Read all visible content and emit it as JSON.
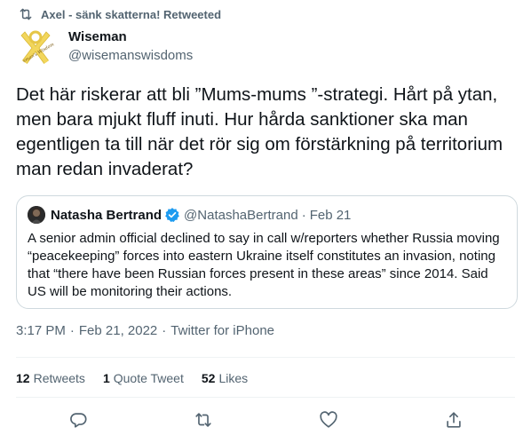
{
  "retweet_bar": {
    "text": "Axel - sänk skatterna! Retweeted",
    "icon": "retweet-icon"
  },
  "author": {
    "name": "Wiseman",
    "handle": "@wisemanswisdoms",
    "avatar_text": "Wiseman's Wisdom",
    "avatar_color": "#f2d65c"
  },
  "tweet": {
    "text": "Det här riskerar att bli ”Mums-mums ”-strategi. Hårt på ytan, men bara mjukt fluff inuti. Hur hårda sanktioner ska man egentligen ta till när det rör sig om förstärkning på territorium man redan invaderat?"
  },
  "quote_tweet": {
    "name": "Natasha Bertrand",
    "verified": true,
    "verified_color": "#1d9bf0",
    "handle": "@NatashaBertrand",
    "separator": "·",
    "date": "Feb 21",
    "text": "A senior admin official declined to say in call w/reporters whether Russia moving “peacekeeping” forces into eastern Ukraine itself constitutes an invasion, noting that “there have been Russian forces present in these areas” since 2014. Said US will be monitoring their actions."
  },
  "meta": {
    "time": "3:17 PM",
    "separator": "·",
    "date": "Feb 21, 2022",
    "source": "Twitter for iPhone"
  },
  "stats": {
    "retweets_count": "12",
    "retweets_label": "Retweets",
    "quote_count": "1",
    "quote_label": "Quote Tweet",
    "likes_count": "52",
    "likes_label": "Likes"
  },
  "actions": {
    "reply_icon": "reply-icon",
    "retweet_icon": "retweet-icon",
    "like_icon": "heart-icon",
    "share_icon": "share-icon"
  },
  "colors": {
    "text_primary": "#0f1419",
    "text_secondary": "#536471",
    "border": "#cfd9de",
    "divider": "#eff3f4"
  }
}
